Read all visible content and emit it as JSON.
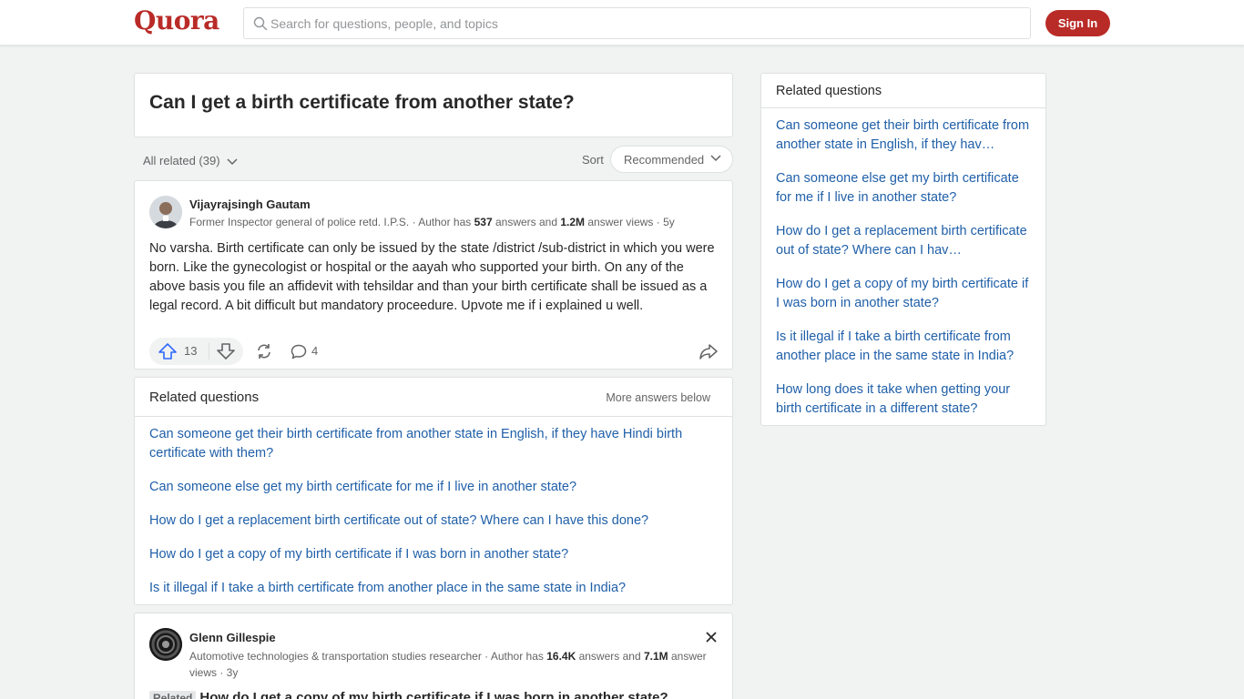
{
  "header": {
    "logo": "Quora",
    "search_placeholder": "Search for questions, people, and topics",
    "signin_label": "Sign In"
  },
  "question": {
    "title": "Can I get a birth certificate from another state?"
  },
  "filters": {
    "all_related": "All related (39)",
    "sort_label": "Sort",
    "sort_value": "Recommended"
  },
  "answer1": {
    "author": "Vijayrajsingh Gautam",
    "credential_prefix": "Former Inspector general of police retd. I.P.S. · Author has ",
    "answers_count": "537",
    "answers_text": " answers and ",
    "views_count": "1.2M",
    "views_text": " answer views · 5y",
    "body": "No varsha. Birth certificate can only be issued by the state /district /sub-district in which you were born. Like the gynecologist or hospital or the aayah who supported your birth. On any of the above basis you file an affidevit with tehsildar and than your birth certificate shall be issued as a legal record. A bit difficult but mandatory proceedure. Upvote me if i explained u well.",
    "upvotes": "13",
    "comments": "4"
  },
  "related_inline": {
    "title": "Related questions",
    "more": "More answers below",
    "items": [
      "Can someone get their birth certificate from another state in English, if they have Hindi birth certificate with them?",
      "Can someone else get my birth certificate for me if I live in another state?",
      "How do I get a replacement birth certificate out of state? Where can I have this done?",
      "How do I get a copy of my birth certificate if I was born in another state?",
      "Is it illegal if I take a birth certificate from another place in the same state in India?"
    ]
  },
  "answer2": {
    "author": "Glenn Gillespie",
    "credential_prefix": "Automotive technologies & transportation studies researcher · Author has ",
    "answers_count": "16.4K",
    "answers_text": " answers and ",
    "views_count": "7.1M",
    "views_text": " answer views · 3y",
    "related_tag": "Related",
    "related_question": "How do I get a copy of my birth certificate if I was born in another state?"
  },
  "sidebar": {
    "title": "Related questions",
    "items": [
      "Can someone get their birth certificate from another state in English, if they hav…",
      "Can someone else get my birth certificate for me if I live in another state?",
      "How do I get a replacement birth certificate out of state? Where can I hav…",
      "How do I get a copy of my birth certificate if I was born in another state?",
      "Is it illegal if I take a birth certificate from another place in the same state in India?",
      "How long does it take when getting your birth certificate in a different state?"
    ]
  },
  "colors": {
    "brand": "#b92b27",
    "link": "#1f5fa8",
    "upvote": "#2e69ff"
  }
}
